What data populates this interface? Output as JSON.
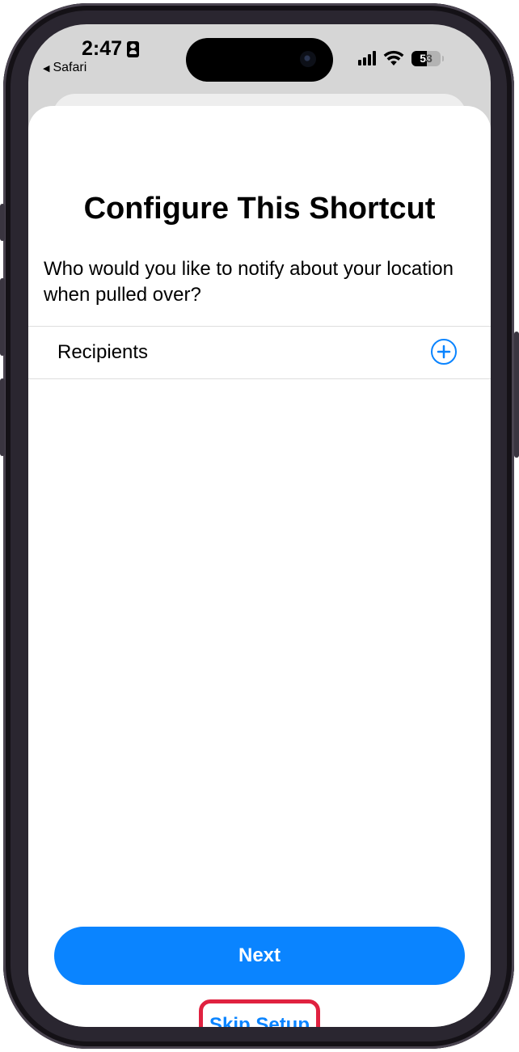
{
  "status_bar": {
    "time": "2:47",
    "back_app": "Safari",
    "battery": "53"
  },
  "sheet": {
    "title": "Configure This Shortcut",
    "question": "Who would you like to notify about your location when pulled over?",
    "recipients_label": "Recipients"
  },
  "buttons": {
    "next_label": "Next",
    "skip_label": "Skip Setup"
  },
  "colors": {
    "accent": "#0a84ff",
    "highlight": "#e0213f"
  }
}
